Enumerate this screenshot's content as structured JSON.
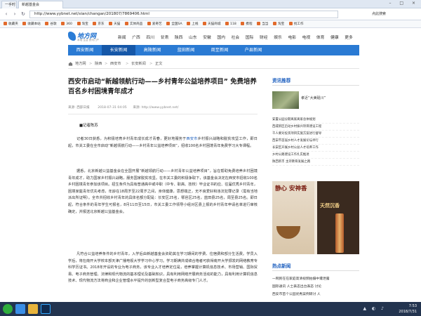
{
  "browser": {
    "tabs": [
      {
        "label": "一手时"
      },
      {
        "label": "新越基金会"
      }
    ],
    "url": "http://www.yybnet.net/xian/changan/201807/7869406.html",
    "addr_right": "点此搜索",
    "bookmarks": [
      "收藏夹",
      "收藏本站",
      "谷歌",
      "360",
      "淘宝",
      "京东",
      "天猫",
      "实体商品",
      "爱奇艺",
      "全国SA",
      "上线",
      "天猫商城",
      "118",
      "携程",
      "当当",
      "淘宝",
      "找工作"
    ]
  },
  "site": {
    "logo_title": "地方网",
    "logo_sub": "本地 生活 资讯门户",
    "top_nav": [
      "新闻",
      "广西",
      "四川",
      "甘肃",
      "陕西",
      "山东",
      "安徽",
      "国内",
      "社会",
      "国际",
      "财经",
      "娱乐",
      "电影",
      "电视",
      "体育",
      "健康",
      "更多"
    ],
    "channels": [
      "西安新闻",
      "长安新闻",
      "高陵新闻",
      "蓝田新闻",
      "周至新闻",
      "户县新闻"
    ]
  },
  "breadcrumb": [
    "地方网",
    "陕西",
    "西安市",
    "长安新闻",
    "正文"
  ],
  "article": {
    "title": "西安市启动“新越领航行动——乡村青年公益培养项目” 免费培养百名乡村困境青年成才",
    "source": "来源: 西部日报",
    "date": "2018-07-31 04:05",
    "site": "来源: http://www.yybnet.net/",
    "byline": "■记者陈苏",
    "paragraphs": [
      {
        "pre": "记者30日获悉，为积极培育乡村青年成长成才青春，更好地服务于",
        "link": "西安市",
        "post": "乡村振兴战略和脱贫攻坚工作，即日起，市关工委在全市启动“新越领航行动——乡村青年公益培养项目”，招收100名乡村困境青年免费学习大专课程。"
      },
      {
        "pre": "据悉，北京新越公益基金会在全国开展“新越领航行动——乡村青年公益培养项目”，旨在帮助免费培养乡村困境青年成才，助力国家乡村振兴战略，服务国家脱贫攻坚。在市关工委的积极争取下，该基金会决定在西安市招收100名乡村困境青年参加该项目。招生条件为具有普通高中或中职（中专、职高、技校）毕业证书的应、往届优秀乡村青年，困境家庭青年优先考虑，年龄在18周岁至22周岁之间，身体健康，思想端正，无不良爱好和违法犯罪记录（需有当地派出所证明）。全市共招收乡村青年的具体名额分配是：长安区25名，鄠邑区25名，蓝田县25名，周至县25名。即日起，符合条件的青年学生可报名，8月11日至15日，市关工委工作领导小组对区县上报的乡村青年申请名单进行审核确定，并报送北京新越公益基金会。",
        "link": "",
        "post": ""
      },
      {
        "pre": "凡符合公益培养条件的乡村青年，入学后由新越基金会资助其在学习期间的学费、住宿费和部分生活费。学员入学后，将在南开大学校本部天津广播电视大学学习中心学习。学习期满并成绩合格者可获得南开大学颁发的网络教育专科学历证书。2018年开设的专业为电子商务，该专业入才培养定位是，培养掌握计算机信息技术、市场营销、国际贸易、电子商务管理、法律和现代物流的基本理论及基础知识，具有利用网络开展商务活动的能力，具有利用计算机信息技术、现代物流方法将商业和企业管理水平提升的创新型复合型电子商务高级专门人才。",
        "link": "",
        "post": ""
      }
    ]
  },
  "sidebar": {
    "header": "资讯推荐",
    "thumb_caption": "孝近“大美砥川”",
    "list": [
      "安置公园分期离家离家总体规划",
      "西咸新区启动乡村振兴项目建设工程",
      "千人要对投资项目实施方案进行督导",
      "西安市首届乡村人才发展论坛举行",
      "长安区开展乡村公益人才培养工作",
      "乡村公路建设工作扎实推进",
      "陕西新丰 主持教育发展之路"
    ],
    "ad_big": "静心 安神香",
    "ad_small": "天然沉香",
    "header2": "热点新闻",
    "list2": [
      "一网民在在家庭高清视频拍摄中遭泄露",
      "国际通讯 人士表态出台表态 讨论",
      "西安市首个公园优秀案例研讨 人"
    ]
  },
  "taskbar": {
    "time": "7:53",
    "date": "2018/7/31"
  },
  "colors": {
    "brand_blue": "#2a7ad3",
    "channel_active": "#1557a8",
    "link_blue": "#1d5fbf",
    "taskbar": "#23344f"
  }
}
